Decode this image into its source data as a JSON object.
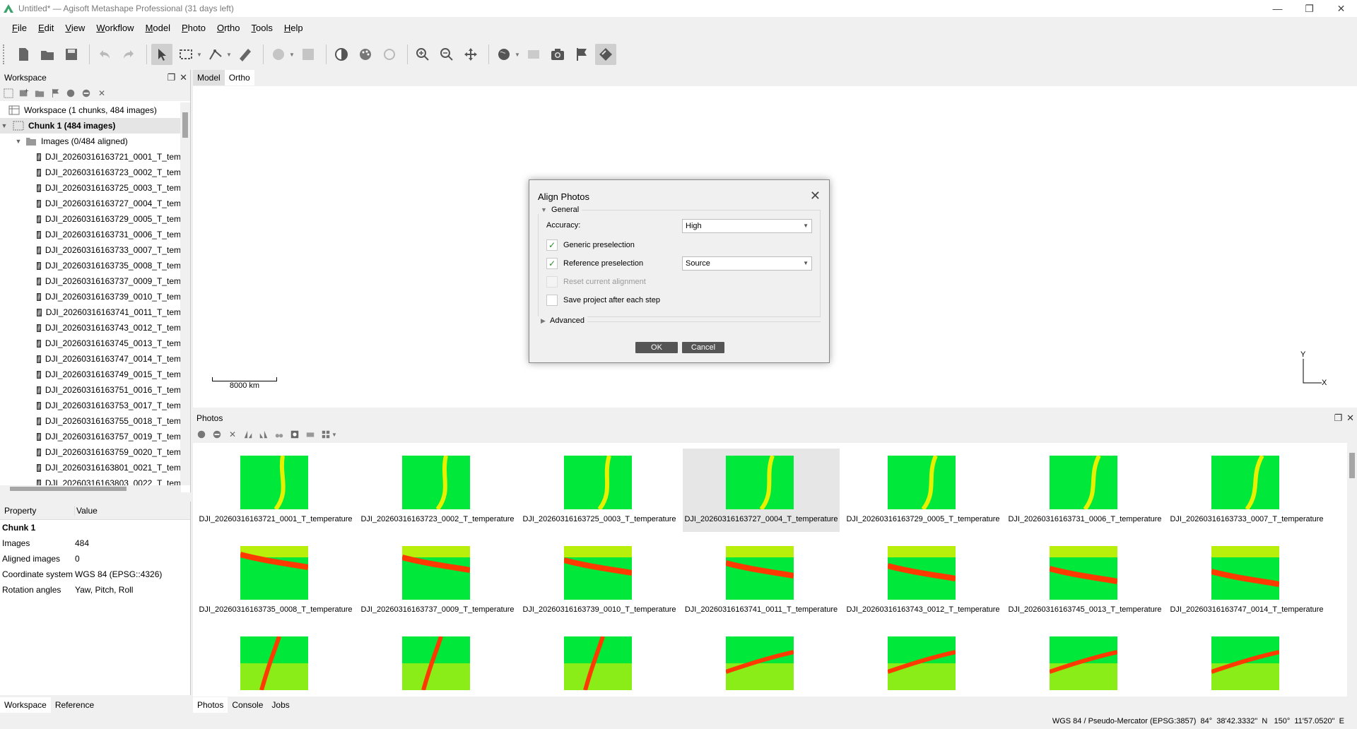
{
  "window": {
    "title": "Untitled* — Agisoft Metashape Professional (31 days left)"
  },
  "menu": [
    {
      "label": "File",
      "u": "F",
      "rest": "ile"
    },
    {
      "label": "Edit",
      "u": "E",
      "rest": "dit"
    },
    {
      "label": "View",
      "u": "V",
      "rest": "iew"
    },
    {
      "label": "Workflow",
      "u": "W",
      "rest": "orkflow"
    },
    {
      "label": "Model",
      "u": "M",
      "rest": "odel"
    },
    {
      "label": "Photo",
      "u": "P",
      "rest": "hoto"
    },
    {
      "label": "Ortho",
      "u": "O",
      "rest": "rtho"
    },
    {
      "label": "Tools",
      "u": "T",
      "rest": "ools"
    },
    {
      "label": "Help",
      "u": "H",
      "rest": "elp"
    }
  ],
  "workspace": {
    "title": "Workspace",
    "root": "Workspace (1 chunks, 484 images)",
    "chunk": "Chunk 1 (484 images)",
    "images_folder": "Images (0/484 aligned)",
    "images": [
      "DJI_20260316163721_0001_T_tem",
      "DJI_20260316163723_0002_T_tem",
      "DJI_20260316163725_0003_T_tem",
      "DJI_20260316163727_0004_T_tem",
      "DJI_20260316163729_0005_T_tem",
      "DJI_20260316163731_0006_T_tem",
      "DJI_20260316163733_0007_T_tem",
      "DJI_20260316163735_0008_T_tem",
      "DJI_20260316163737_0009_T_tem",
      "DJI_20260316163739_0010_T_tem",
      "DJI_20260316163741_0011_T_tem",
      "DJI_20260316163743_0012_T_tem",
      "DJI_20260316163745_0013_T_tem",
      "DJI_20260316163747_0014_T_tem",
      "DJI_20260316163749_0015_T_tem",
      "DJI_20260316163751_0016_T_tem",
      "DJI_20260316163753_0017_T_tem",
      "DJI_20260316163755_0018_T_tem",
      "DJI_20260316163757_0019_T_tem",
      "DJI_20260316163759_0020_T_tem",
      "DJI_20260316163801_0021_T_tem",
      "DJI_20260316163803_0022_T_tem"
    ]
  },
  "properties": {
    "col_property": "Property",
    "col_value": "Value",
    "group": "Chunk 1",
    "rows": [
      {
        "k": "Images",
        "v": "484"
      },
      {
        "k": "Aligned images",
        "v": "0"
      },
      {
        "k": "Coordinate system",
        "v": "WGS 84 (EPSG::4326)"
      },
      {
        "k": "Rotation angles",
        "v": "Yaw, Pitch, Roll"
      }
    ]
  },
  "left_tabs": [
    "Workspace",
    "Reference"
  ],
  "view_tabs": [
    "Model",
    "Ortho"
  ],
  "viewport": {
    "scale_label": "8000 km",
    "axis_y": "Y",
    "axis_x": "X"
  },
  "photos": {
    "title": "Photos",
    "items": [
      "DJI_20260316163721_0001_T_temperature",
      "DJI_20260316163723_0002_T_temperature",
      "DJI_20260316163725_0003_T_temperature",
      "DJI_20260316163727_0004_T_temperature",
      "DJI_20260316163729_0005_T_temperature",
      "DJI_20260316163731_0006_T_temperature",
      "DJI_20260316163733_0007_T_temperature",
      "DJI_20260316163735_0008_T_temperature",
      "DJI_20260316163737_0009_T_temperature",
      "DJI_20260316163739_0010_T_temperature",
      "DJI_20260316163741_0011_T_temperature",
      "DJI_20260316163743_0012_T_temperature",
      "DJI_20260316163745_0013_T_temperature",
      "DJI_20260316163747_0014_T_temperature",
      "",
      "",
      "",
      "",
      "",
      "",
      ""
    ]
  },
  "bottom_tabs": [
    "Photos",
    "Console",
    "Jobs"
  ],
  "status": {
    "coords": "WGS 84 / Pseudo-Mercator (EPSG:3857)  84°  38'42.3332\"  N   150°  11'57.0520\"  E"
  },
  "dialog": {
    "title": "Align Photos",
    "general": "General",
    "accuracy_label": "Accuracy:",
    "accuracy_value": "High",
    "generic_preselection": "Generic preselection",
    "reference_preselection": "Reference preselection",
    "reference_value": "Source",
    "reset_alignment": "Reset current alignment",
    "save_project": "Save project after each step",
    "advanced": "Advanced",
    "ok": "OK",
    "cancel": "Cancel"
  },
  "colors": {
    "thermal_low": "#00e83a",
    "thermal_mid": "#e6f000",
    "thermal_high": "#ff3a00"
  }
}
